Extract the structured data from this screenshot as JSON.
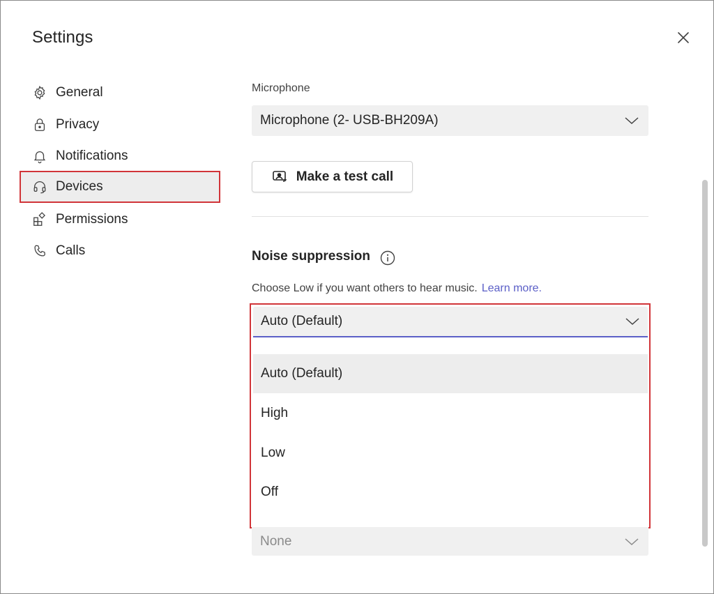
{
  "dialog": {
    "title": "Settings",
    "close_icon": "close-icon"
  },
  "sidebar": {
    "items": [
      {
        "label": "General",
        "icon": "gear-icon"
      },
      {
        "label": "Privacy",
        "icon": "lock-icon"
      },
      {
        "label": "Notifications",
        "icon": "bell-icon"
      },
      {
        "label": "Devices",
        "icon": "headset-icon",
        "selected": true
      },
      {
        "label": "Permissions",
        "icon": "apps-icon"
      },
      {
        "label": "Calls",
        "icon": "phone-icon"
      }
    ]
  },
  "devices": {
    "microphone_label": "Microphone",
    "microphone_value": "Microphone (2- USB-BH209A)",
    "test_call_label": "Make a test call",
    "noise_title": "Noise suppression",
    "noise_desc": "Choose Low if you want others to hear music.",
    "learn_more": "Learn more.",
    "noise_selected": "Auto (Default)",
    "noise_options": [
      "Auto (Default)",
      "High",
      "Low",
      "Off"
    ],
    "hovered_option": "Auto (Default)",
    "next_field_value": "None"
  },
  "colors": {
    "highlight_border": "#d13438",
    "accent": "#5b5fc7",
    "selected_bg": "#ededed",
    "field_bg": "#f0f0f0"
  }
}
